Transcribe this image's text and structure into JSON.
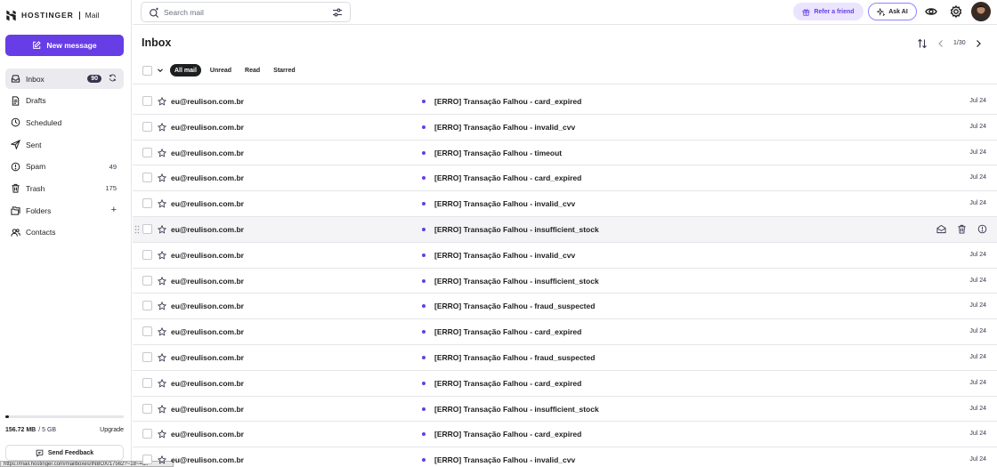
{
  "brand": {
    "name": "HOSTINGER",
    "product": "Mail"
  },
  "compose": {
    "label": "New message"
  },
  "nav": [
    {
      "label": "Inbox",
      "badge": "90",
      "icon": "inbox-icon"
    },
    {
      "label": "Drafts",
      "icon": "draft-icon"
    },
    {
      "label": "Scheduled",
      "icon": "clock-icon"
    },
    {
      "label": "Sent",
      "icon": "send-icon"
    },
    {
      "label": "Spam",
      "count": "49",
      "icon": "spam-icon"
    },
    {
      "label": "Trash",
      "count": "175",
      "icon": "trash-icon"
    },
    {
      "label": "Folders",
      "icon": "folder-icon"
    },
    {
      "label": "Contacts",
      "icon": "contacts-icon"
    }
  ],
  "storage": {
    "used": "156.72 MB",
    "total": "/ 5 GB",
    "upgrade": "Upgrade",
    "used_fraction": 0.03
  },
  "feedback": {
    "label": "Send Feedback"
  },
  "statusbar": {
    "url": "https://mail.hostinger.com/mailboxes/INBOX/17562?~18~=all"
  },
  "header": {
    "search_placeholder": "Search mail",
    "refer_label": "Refer a friend",
    "askai_label": "Ask AI"
  },
  "main": {
    "title": "Inbox",
    "pagination": "1/30",
    "filters": [
      "All mail",
      "Unread",
      "Read",
      "Starred"
    ]
  },
  "emails": [
    {
      "sender": "eu@reulison.com.br",
      "subject": "[ERRO] Transação Falhou - card_expired",
      "date": "Jul 24"
    },
    {
      "sender": "eu@reulison.com.br",
      "subject": "[ERRO] Transação Falhou - invalid_cvv",
      "date": "Jul 24"
    },
    {
      "sender": "eu@reulison.com.br",
      "subject": "[ERRO] Transação Falhou - timeout",
      "date": "Jul 24"
    },
    {
      "sender": "eu@reulison.com.br",
      "subject": "[ERRO] Transação Falhou - card_expired",
      "date": "Jul 24"
    },
    {
      "sender": "eu@reulison.com.br",
      "subject": "[ERRO] Transação Falhou - invalid_cvv",
      "date": "Jul 24"
    },
    {
      "sender": "eu@reulison.com.br",
      "subject": "[ERRO] Transação Falhou - insufficient_stock",
      "date": ""
    },
    {
      "sender": "eu@reulison.com.br",
      "subject": "[ERRO] Transação Falhou - invalid_cvv",
      "date": "Jul 24"
    },
    {
      "sender": "eu@reulison.com.br",
      "subject": "[ERRO] Transação Falhou - insufficient_stock",
      "date": "Jul 24"
    },
    {
      "sender": "eu@reulison.com.br",
      "subject": "[ERRO] Transação Falhou - fraud_suspected",
      "date": "Jul 24"
    },
    {
      "sender": "eu@reulison.com.br",
      "subject": "[ERRO] Transação Falhou - card_expired",
      "date": "Jul 24"
    },
    {
      "sender": "eu@reulison.com.br",
      "subject": "[ERRO] Transação Falhou - fraud_suspected",
      "date": "Jul 24"
    },
    {
      "sender": "eu@reulison.com.br",
      "subject": "[ERRO] Transação Falhou - card_expired",
      "date": "Jul 24"
    },
    {
      "sender": "eu@reulison.com.br",
      "subject": "[ERRO] Transação Falhou - insufficient_stock",
      "date": "Jul 24"
    },
    {
      "sender": "eu@reulison.com.br",
      "subject": "[ERRO] Transação Falhou - card_expired",
      "date": "Jul 24"
    },
    {
      "sender": "eu@reulison.com.br",
      "subject": "[ERRO] Transação Falhou - invalid_cvv",
      "date": "Jul 24"
    }
  ],
  "colors": {
    "accent": "#673de6",
    "unread_dot": "#673de6",
    "dark": "#1d1e20",
    "refer_bg": "#ebe4ff"
  }
}
